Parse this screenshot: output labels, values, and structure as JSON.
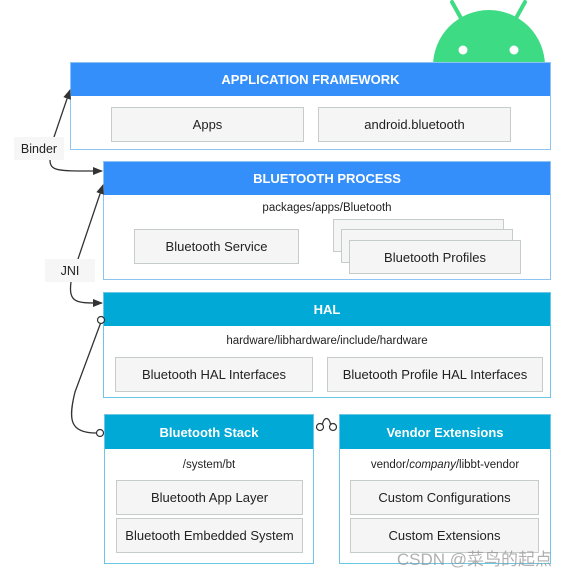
{
  "colors": {
    "framework_header": "#348ffb",
    "hal_header": "#00a9d6",
    "android_green": "#3ddc84",
    "box_fill": "#f5f5f5"
  },
  "logo": {
    "name": "android-robot-icon"
  },
  "framework": {
    "title": "APPLICATION FRAMEWORK",
    "items": [
      "Apps",
      "android.bluetooth"
    ]
  },
  "process": {
    "title": "BLUETOOTH PROCESS",
    "path": "packages/apps/Bluetooth",
    "service": "Bluetooth Service",
    "profiles": "Bluetooth Profiles"
  },
  "hal": {
    "title": "HAL",
    "path": "hardware/libhardware/include/hardware",
    "items": [
      "Bluetooth HAL Interfaces",
      "Bluetooth Profile HAL Interfaces"
    ]
  },
  "stack": {
    "title": "Bluetooth Stack",
    "path": "/system/bt",
    "items": [
      "Bluetooth App Layer",
      "Bluetooth Embedded System"
    ]
  },
  "vendor": {
    "title": "Vendor Extensions",
    "path_pre": "vendor/",
    "path_italic": "company",
    "path_post": "/libbt-vendor",
    "items": [
      "Custom Configurations",
      "Custom Extensions"
    ]
  },
  "connectors": {
    "binder": "Binder",
    "jni": "JNI"
  },
  "watermark": "CSDN @菜鸟的起点"
}
